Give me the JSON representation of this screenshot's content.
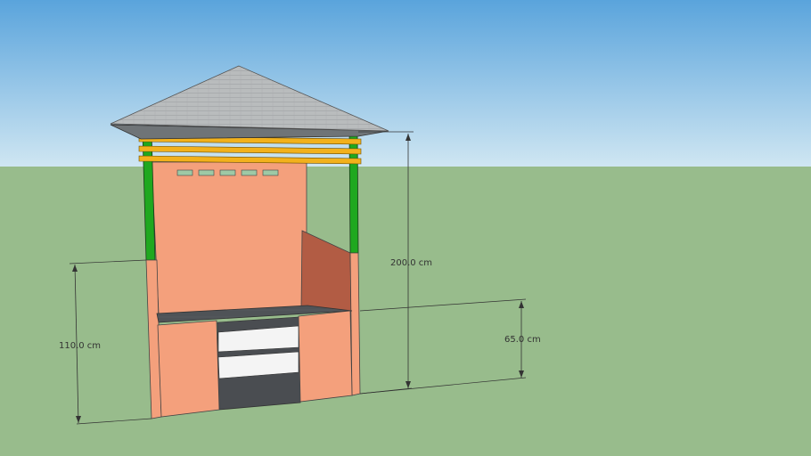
{
  "scene": {
    "colors": {
      "sky_top": "#5aa4dc",
      "sky_bottom": "#cfe6f2",
      "ground": "#98bc8c",
      "wall": "#f4a07c",
      "wall_shade": "#b25c44",
      "roof": "#b9bcbd",
      "roof_edge": "#6f7477",
      "post": "#1fa81f",
      "rail": "#f2b11c",
      "dark": "#4a4d51",
      "shelf": "#f4f4f4",
      "dimension": "#333333"
    },
    "dimensions": [
      {
        "id": "overall-height",
        "label": "200.0 cm"
      },
      {
        "id": "wall-height",
        "label": "110.0 cm"
      },
      {
        "id": "counter-height",
        "label": "65.0 cm"
      }
    ]
  }
}
